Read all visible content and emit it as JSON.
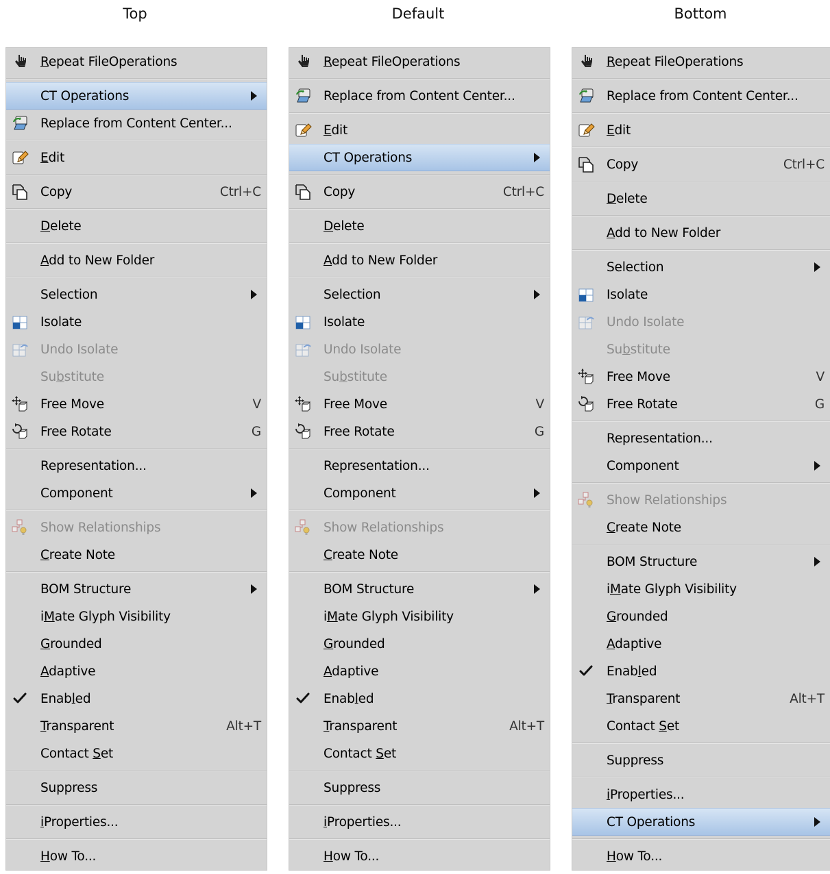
{
  "columns": [
    {
      "title": "Top",
      "items": [
        {
          "type": "item",
          "label": "Repeat FileOperations",
          "ul": 0,
          "icon": "hand-icon"
        },
        {
          "type": "sep"
        },
        {
          "type": "item",
          "label": "CT Operations",
          "submenu": true,
          "highlighted": true
        },
        {
          "type": "item",
          "label": "Replace from Content Center...",
          "icon": "replace-icon"
        },
        {
          "type": "sep"
        },
        {
          "type": "item",
          "label": "Edit",
          "ul": 0,
          "icon": "edit-icon"
        },
        {
          "type": "sep"
        },
        {
          "type": "item",
          "label": "Copy",
          "shortcut": "Ctrl+C",
          "icon": "copy-icon"
        },
        {
          "type": "sep"
        },
        {
          "type": "item",
          "label": "Delete",
          "ul": 0
        },
        {
          "type": "sep"
        },
        {
          "type": "item",
          "label": "Add to New Folder",
          "ul": 0
        },
        {
          "type": "sep"
        },
        {
          "type": "item",
          "label": "Selection",
          "submenu": true
        },
        {
          "type": "item",
          "label": "Isolate",
          "icon": "isolate-icon"
        },
        {
          "type": "item",
          "label": "Undo Isolate",
          "icon": "undo-isolate-icon",
          "disabled": true
        },
        {
          "type": "item",
          "label": "Substitute",
          "ul": 2,
          "disabled": true
        },
        {
          "type": "item",
          "label": "Free Move",
          "shortcut": "V",
          "icon": "free-move-icon"
        },
        {
          "type": "item",
          "label": "Free Rotate",
          "shortcut": "G",
          "icon": "free-rotate-icon"
        },
        {
          "type": "sep"
        },
        {
          "type": "item",
          "label": "Representation..."
        },
        {
          "type": "item",
          "label": "Component",
          "submenu": true
        },
        {
          "type": "sep"
        },
        {
          "type": "item",
          "label": "Show Relationships",
          "icon": "relationships-icon",
          "disabled": true
        },
        {
          "type": "item",
          "label": "Create Note",
          "ul": 0
        },
        {
          "type": "sep"
        },
        {
          "type": "item",
          "label": "BOM Structure",
          "submenu": true
        },
        {
          "type": "item",
          "label": "iMate Glyph Visibility",
          "ul": 1
        },
        {
          "type": "item",
          "label": "Grounded",
          "ul": 0
        },
        {
          "type": "item",
          "label": "Adaptive",
          "ul": 0
        },
        {
          "type": "item",
          "label": "Enabled",
          "ul": 4,
          "icon": "check-icon"
        },
        {
          "type": "item",
          "label": "Transparent",
          "ul": 0,
          "shortcut": "Alt+T"
        },
        {
          "type": "item",
          "label": "Contact Set",
          "ul": 8
        },
        {
          "type": "sep"
        },
        {
          "type": "item",
          "label": "Suppress"
        },
        {
          "type": "sep"
        },
        {
          "type": "item",
          "label": "iProperties...",
          "ul": 0
        },
        {
          "type": "sep"
        },
        {
          "type": "item",
          "label": "How To...",
          "ul": 0
        }
      ]
    },
    {
      "title": "Default",
      "items": [
        {
          "type": "item",
          "label": "Repeat FileOperations",
          "ul": 0,
          "icon": "hand-icon"
        },
        {
          "type": "sep"
        },
        {
          "type": "item",
          "label": "Replace from Content Center...",
          "icon": "replace-icon"
        },
        {
          "type": "sep"
        },
        {
          "type": "item",
          "label": "Edit",
          "ul": 0,
          "icon": "edit-icon"
        },
        {
          "type": "item",
          "label": "CT Operations",
          "submenu": true,
          "highlighted": true
        },
        {
          "type": "sep"
        },
        {
          "type": "item",
          "label": "Copy",
          "shortcut": "Ctrl+C",
          "icon": "copy-icon"
        },
        {
          "type": "sep"
        },
        {
          "type": "item",
          "label": "Delete",
          "ul": 0
        },
        {
          "type": "sep"
        },
        {
          "type": "item",
          "label": "Add to New Folder",
          "ul": 0
        },
        {
          "type": "sep"
        },
        {
          "type": "item",
          "label": "Selection",
          "submenu": true
        },
        {
          "type": "item",
          "label": "Isolate",
          "icon": "isolate-icon"
        },
        {
          "type": "item",
          "label": "Undo Isolate",
          "icon": "undo-isolate-icon",
          "disabled": true
        },
        {
          "type": "item",
          "label": "Substitute",
          "ul": 2,
          "disabled": true
        },
        {
          "type": "item",
          "label": "Free Move",
          "shortcut": "V",
          "icon": "free-move-icon"
        },
        {
          "type": "item",
          "label": "Free Rotate",
          "shortcut": "G",
          "icon": "free-rotate-icon"
        },
        {
          "type": "sep"
        },
        {
          "type": "item",
          "label": "Representation..."
        },
        {
          "type": "item",
          "label": "Component",
          "submenu": true
        },
        {
          "type": "sep"
        },
        {
          "type": "item",
          "label": "Show Relationships",
          "icon": "relationships-icon",
          "disabled": true
        },
        {
          "type": "item",
          "label": "Create Note",
          "ul": 0
        },
        {
          "type": "sep"
        },
        {
          "type": "item",
          "label": "BOM Structure",
          "submenu": true
        },
        {
          "type": "item",
          "label": "iMate Glyph Visibility",
          "ul": 1
        },
        {
          "type": "item",
          "label": "Grounded",
          "ul": 0
        },
        {
          "type": "item",
          "label": "Adaptive",
          "ul": 0
        },
        {
          "type": "item",
          "label": "Enabled",
          "ul": 4,
          "icon": "check-icon"
        },
        {
          "type": "item",
          "label": "Transparent",
          "ul": 0,
          "shortcut": "Alt+T"
        },
        {
          "type": "item",
          "label": "Contact Set",
          "ul": 8
        },
        {
          "type": "sep"
        },
        {
          "type": "item",
          "label": "Suppress"
        },
        {
          "type": "sep"
        },
        {
          "type": "item",
          "label": "iProperties...",
          "ul": 0
        },
        {
          "type": "sep"
        },
        {
          "type": "item",
          "label": "How To...",
          "ul": 0
        }
      ]
    },
    {
      "title": "Bottom",
      "items": [
        {
          "type": "item",
          "label": "Repeat FileOperations",
          "ul": 0,
          "icon": "hand-icon"
        },
        {
          "type": "sep"
        },
        {
          "type": "item",
          "label": "Replace from Content Center...",
          "icon": "replace-icon"
        },
        {
          "type": "sep"
        },
        {
          "type": "item",
          "label": "Edit",
          "ul": 0,
          "icon": "edit-icon"
        },
        {
          "type": "sep"
        },
        {
          "type": "item",
          "label": "Copy",
          "shortcut": "Ctrl+C",
          "icon": "copy-icon"
        },
        {
          "type": "sep"
        },
        {
          "type": "item",
          "label": "Delete",
          "ul": 0
        },
        {
          "type": "sep"
        },
        {
          "type": "item",
          "label": "Add to New Folder",
          "ul": 0
        },
        {
          "type": "sep"
        },
        {
          "type": "item",
          "label": "Selection",
          "submenu": true
        },
        {
          "type": "item",
          "label": "Isolate",
          "icon": "isolate-icon"
        },
        {
          "type": "item",
          "label": "Undo Isolate",
          "icon": "undo-isolate-icon",
          "disabled": true
        },
        {
          "type": "item",
          "label": "Substitute",
          "ul": 2,
          "disabled": true
        },
        {
          "type": "item",
          "label": "Free Move",
          "shortcut": "V",
          "icon": "free-move-icon"
        },
        {
          "type": "item",
          "label": "Free Rotate",
          "shortcut": "G",
          "icon": "free-rotate-icon"
        },
        {
          "type": "sep"
        },
        {
          "type": "item",
          "label": "Representation..."
        },
        {
          "type": "item",
          "label": "Component",
          "submenu": true
        },
        {
          "type": "sep"
        },
        {
          "type": "item",
          "label": "Show Relationships",
          "icon": "relationships-icon",
          "disabled": true
        },
        {
          "type": "item",
          "label": "Create Note",
          "ul": 0
        },
        {
          "type": "sep"
        },
        {
          "type": "item",
          "label": "BOM Structure",
          "submenu": true
        },
        {
          "type": "item",
          "label": "iMate Glyph Visibility",
          "ul": 1
        },
        {
          "type": "item",
          "label": "Grounded",
          "ul": 0
        },
        {
          "type": "item",
          "label": "Adaptive",
          "ul": 0
        },
        {
          "type": "item",
          "label": "Enabled",
          "ul": 4,
          "icon": "check-icon"
        },
        {
          "type": "item",
          "label": "Transparent",
          "ul": 0,
          "shortcut": "Alt+T"
        },
        {
          "type": "item",
          "label": "Contact Set",
          "ul": 8
        },
        {
          "type": "sep"
        },
        {
          "type": "item",
          "label": "Suppress"
        },
        {
          "type": "sep"
        },
        {
          "type": "item",
          "label": "iProperties...",
          "ul": 0
        },
        {
          "type": "item",
          "label": "CT Operations",
          "submenu": true,
          "highlighted": true
        },
        {
          "type": "sep"
        },
        {
          "type": "item",
          "label": "How To...",
          "ul": 0
        }
      ]
    }
  ]
}
